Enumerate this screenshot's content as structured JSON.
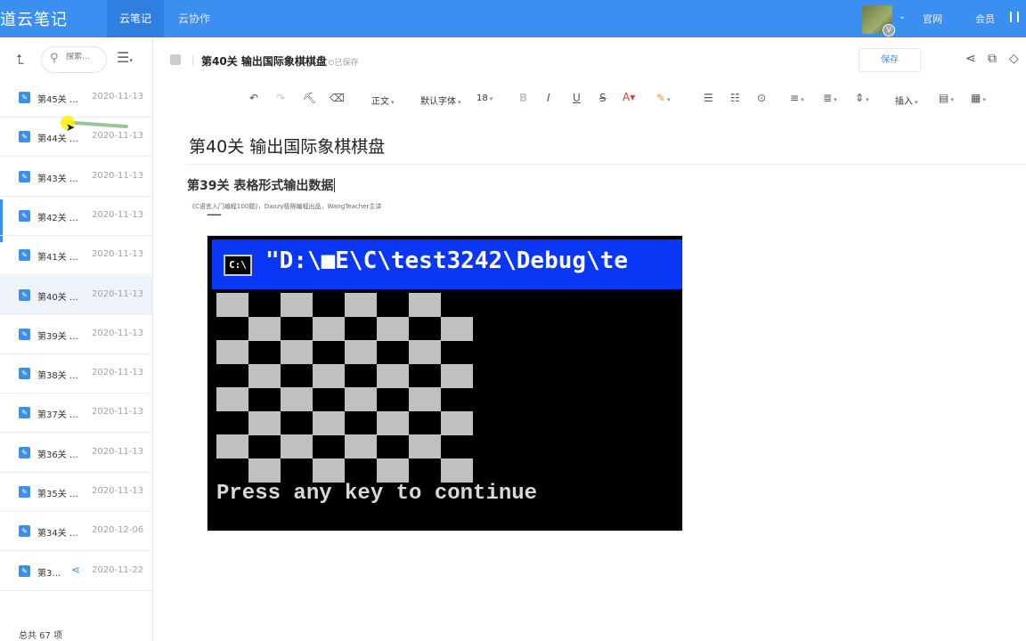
{
  "app": {
    "title": "道云笔记",
    "tabs": [
      {
        "label": "云笔记",
        "active": true
      },
      {
        "label": "云协作",
        "active": false
      }
    ],
    "links": [
      "官网",
      "会员"
    ],
    "accent_color": "#3b8ff0"
  },
  "sidebar": {
    "search_placeholder": "搜索...",
    "notes": [
      {
        "title": "第45关 …",
        "date": "2020-11-13"
      },
      {
        "title": "第44关 …",
        "date": "2020-11-13"
      },
      {
        "title": "第43关 …",
        "date": "2020-11-13"
      },
      {
        "title": "第42关 …",
        "date": "2020-11-13"
      },
      {
        "title": "第41关 …",
        "date": "2020-11-13"
      },
      {
        "title": "第40关 …",
        "date": "2020-11-13",
        "active": true
      },
      {
        "title": "第39关 …",
        "date": "2020-11-13"
      },
      {
        "title": "第38关 …",
        "date": "2020-11-13"
      },
      {
        "title": "第37关 …",
        "date": "2020-11-13"
      },
      {
        "title": "第36关 …",
        "date": "2020-11-13"
      },
      {
        "title": "第35关 …",
        "date": "2020-11-13"
      },
      {
        "title": "第34关 …",
        "date": "2020-12-06"
      },
      {
        "title": "第3…",
        "date": "2020-11-22",
        "shared": true
      }
    ],
    "total_label": "总共 67 项"
  },
  "editor": {
    "doc_title": "第40关 输出国际象棋棋盘",
    "saved_status": "已保存",
    "save_label": "保存",
    "toolbar": {
      "paragraph": "正文",
      "font": "默认字体",
      "size": "18",
      "insert": "插入"
    },
    "body_title": "第40关 输出国际象棋棋盘",
    "subtitle": "第39关 表格形式输出数据",
    "caption": "《C语言入门编程100题》，Daozy极限编程出品，WangTeacher主讲"
  },
  "console": {
    "title_path": "\"D:\\■E\\C\\test3242\\Debug\\te",
    "icon_text": "C:\\",
    "prompt": "Press any key to continue",
    "board_rows": 8,
    "board_cols": 8
  }
}
